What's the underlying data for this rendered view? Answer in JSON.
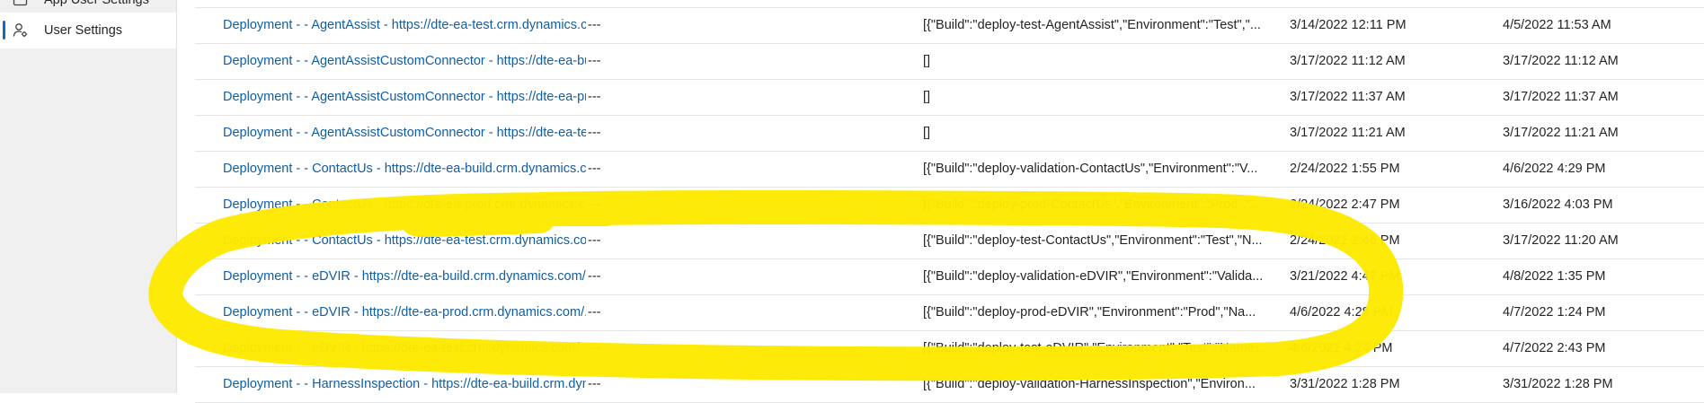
{
  "sidebar": {
    "items": [
      {
        "label": "App User Settings",
        "icon": "settings-icon"
      },
      {
        "label": "User Settings",
        "icon": "user-settings-icon",
        "selected": true
      }
    ]
  },
  "rows": [
    {
      "name": "Deployment -  - AgentAssist - https://dte-ea-test.crm.dynamics.com",
      "description": "---",
      "value": "[{\"Build\":\"deploy-test-AgentAssist\",\"Environment\":\"Test\",\"...",
      "created": "3/14/2022 12:11 PM",
      "modified": "4/5/2022 11:53 AM"
    },
    {
      "name": "Deployment -  - AgentAssistCustomConnector - https://dte-ea-build",
      "description": "---",
      "value": "[]",
      "created": "3/17/2022 11:12 AM",
      "modified": "3/17/2022 11:12 AM"
    },
    {
      "name": "Deployment -  - AgentAssistCustomConnector - https://dte-ea-prod",
      "description": "---",
      "value": "[]",
      "created": "3/17/2022 11:37 AM",
      "modified": "3/17/2022 11:37 AM"
    },
    {
      "name": "Deployment -  - AgentAssistCustomConnector - https://dte-ea-test",
      "description": "---",
      "value": "[]",
      "created": "3/17/2022 11:21 AM",
      "modified": "3/17/2022 11:21 AM"
    },
    {
      "name": "Deployment -  - ContactUs - https://dte-ea-build.crm.dynamics.com",
      "description": "---",
      "value": "[{\"Build\":\"deploy-validation-ContactUs\",\"Environment\":\"V...",
      "created": "2/24/2022 1:55 PM",
      "modified": "4/6/2022 4:29 PM"
    },
    {
      "name": "Deployment -  - ContactUs - https://dte-ea-prod.crm.dynamics.com",
      "description": "---",
      "value": "[{\"Build\":\"deploy-prod-ContactUs\",\"Environment\":\"Prod\",\"...",
      "created": "2/24/2022 2:47 PM",
      "modified": "3/16/2022 4:03 PM"
    },
    {
      "name": "Deployment -  - ContactUs - https://dte-ea-test.crm.dynamics.com",
      "description": "---",
      "value": "[{\"Build\":\"deploy-test-ContactUs\",\"Environment\":\"Test\",\"N...",
      "created": "2/24/2022 2:46 PM",
      "modified": "3/17/2022 11:20 AM"
    },
    {
      "name": "Deployment -  - eDVIR - https://dte-ea-build.crm.dynamics.com/.",
      "description": "---",
      "value": "[{\"Build\":\"deploy-validation-eDVIR\",\"Environment\":\"Valida...",
      "created": "3/21/2022 4:47 PM",
      "modified": "4/8/2022 1:35 PM"
    },
    {
      "name": "Deployment -  - eDVIR - https://dte-ea-prod.crm.dynamics.com/.",
      "description": "---",
      "value": "[{\"Build\":\"deploy-prod-eDVIR\",\"Environment\":\"Prod\",\"Na...",
      "created": "4/6/2022 4:28 PM",
      "modified": "4/7/2022 1:24 PM"
    },
    {
      "name": "Deployment -  - eDVIR - https://dte-ea-test.crm.dynamics.com/",
      "description": "---",
      "value": "[{\"Build\":\"deploy-test-eDVIR\",\"Environment\":\"Test\",\"Name...",
      "created": "4/6/2022 4:24 PM",
      "modified": "4/7/2022 2:43 PM"
    },
    {
      "name": "Deployment -  - HarnessInspection - https://dte-ea-build.crm.dyn",
      "description": "---",
      "value": "[{\"Build\":\"deploy-validation-HarnessInspection\",\"Environ...",
      "created": "3/31/2022 1:28 PM",
      "modified": "3/31/2022 1:28 PM"
    }
  ],
  "annotation": {
    "color": "#fde900"
  }
}
